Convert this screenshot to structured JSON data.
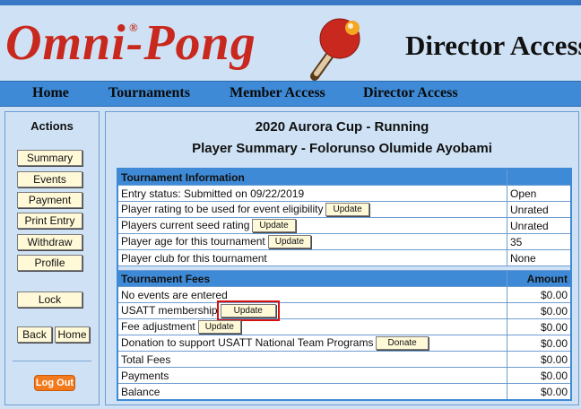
{
  "header": {
    "logo_text": "Omni-Pong",
    "logo_reg": "®",
    "title": "Director Access",
    "paddle_icon": "ping-pong-paddle-icon"
  },
  "nav": [
    {
      "label": "Home"
    },
    {
      "label": "Tournaments"
    },
    {
      "label": "Member Access"
    },
    {
      "label": "Director Access"
    }
  ],
  "sidebar": {
    "title": "Actions",
    "buttons": {
      "summary": "Summary",
      "events": "Events",
      "payment": "Payment",
      "print_entry": "Print Entry",
      "withdraw": "Withdraw",
      "profile": "Profile",
      "lock": "Lock",
      "back": "Back",
      "home": "Home",
      "logout": "Log Out"
    }
  },
  "main": {
    "tournament_title": "2020 Aurora Cup - Running",
    "player_title": "Player Summary - Folorunso Olumide Ayobami",
    "info_header": "Tournament Information",
    "info_rows": [
      {
        "label": "Entry status: Submitted on 09/22/2019",
        "value": "Open"
      },
      {
        "label": "Player rating to be used for event eligibility",
        "button": "Update",
        "value": "Unrated"
      },
      {
        "label": "Players current seed rating",
        "button": "Update",
        "value": "Unrated"
      },
      {
        "label": "Player age for this tournament",
        "button": "Update",
        "value": "35"
      },
      {
        "label": "Player club for this tournament",
        "value": "None"
      }
    ],
    "fees_header": "Tournament Fees",
    "fees_amount_header": "Amount",
    "fee_rows": [
      {
        "label": "No events are entered",
        "value": "$0.00"
      },
      {
        "label": "USATT membership",
        "button": "Update",
        "value": "$0.00"
      },
      {
        "label": "Fee adjustment",
        "button": "Update",
        "value": "$0.00"
      },
      {
        "label": "Donation to support USATT National Team Programs",
        "button": "Donate",
        "value": "$0.00"
      },
      {
        "label": "Total Fees",
        "value": "$0.00"
      },
      {
        "label": "Payments",
        "value": "$0.00"
      },
      {
        "label": "Balance",
        "value": "$0.00"
      }
    ]
  },
  "colors": {
    "brand_red": "#c8281e",
    "nav_blue": "#3e8ad6",
    "panel_bg": "#cfe2f5",
    "button_bg": "#fff9d8",
    "logout_orange": "#f27a1c",
    "highlight_red": "#d81010"
  }
}
